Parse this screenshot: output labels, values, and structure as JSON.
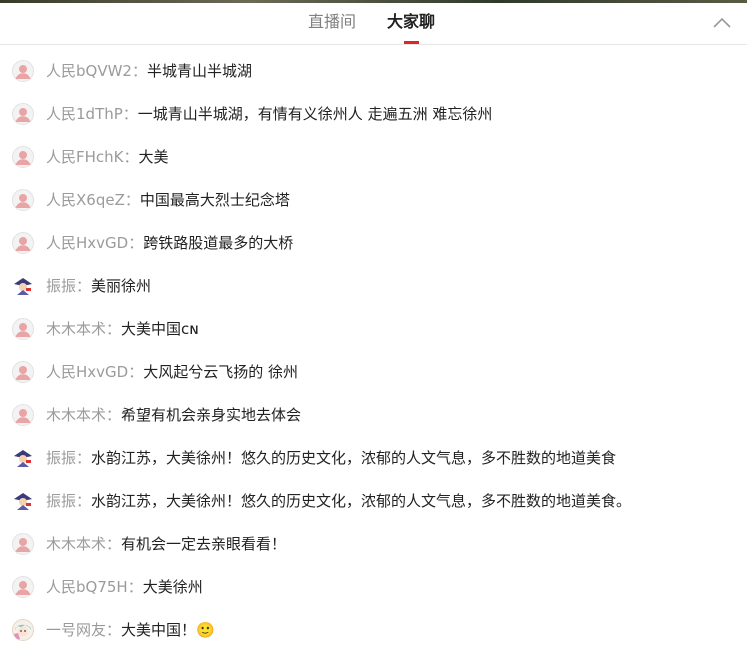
{
  "tabs": {
    "live": "直播间",
    "chat": "大家聊"
  },
  "chat": {
    "separator": "：",
    "messages": [
      {
        "avatar": "person-avatar-icon",
        "user": "人民bQVW2",
        "text": "半城青山半城湖"
      },
      {
        "avatar": "person-avatar-icon",
        "user": "人民1dThP",
        "text": "一城青山半城湖，有情有义徐州人 走遍五洲 难忘徐州"
      },
      {
        "avatar": "person-avatar-icon",
        "user": "人民FHchK",
        "text": "大美"
      },
      {
        "avatar": "person-avatar-icon",
        "user": "人民X6qeZ",
        "text": "中国最高大烈士纪念塔"
      },
      {
        "avatar": "person-avatar-icon",
        "user": "人民HxvGD",
        "text": "跨铁路股道最多的大桥"
      },
      {
        "avatar": "cartoon-avatar-icon",
        "user": "振振",
        "text": "美丽徐州"
      },
      {
        "avatar": "person-avatar-icon",
        "user": "木木本术",
        "text": "大美中国ᴄɴ"
      },
      {
        "avatar": "person-avatar-icon",
        "user": "人民HxvGD",
        "text": "大风起兮云飞扬的 徐州"
      },
      {
        "avatar": "person-avatar-icon",
        "user": "木木本术",
        "text": "希望有机会亲身实地去体会"
      },
      {
        "avatar": "cartoon-avatar-icon",
        "user": "振振",
        "text": "水韵江苏，大美徐州！悠久的历史文化，浓郁的人文气息，多不胜数的地道美食"
      },
      {
        "avatar": "cartoon-avatar-icon",
        "user": "振振",
        "text": "水韵江苏，大美徐州！悠久的历史文化，浓郁的人文气息，多不胜数的地道美食。"
      },
      {
        "avatar": "person-avatar-icon",
        "user": "木木本术",
        "text": "有机会一定去亲眼看看！"
      },
      {
        "avatar": "person-avatar-icon",
        "user": "人民bQ75H",
        "text": "大美徐州"
      },
      {
        "avatar": "anime-avatar-icon",
        "user": "一号网友",
        "text": "大美中国！🙂"
      }
    ]
  },
  "colors": {
    "accent": "#d7282e",
    "username": "#9b9b9b",
    "message": "#222222"
  }
}
